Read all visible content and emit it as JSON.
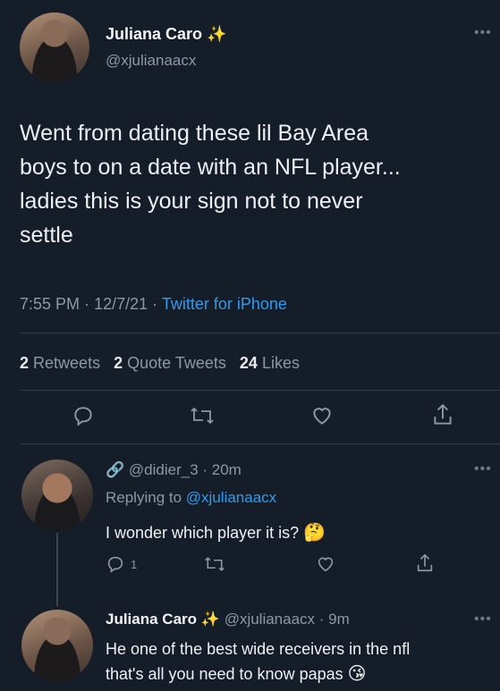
{
  "tweet": {
    "author_name": "Juliana Caro",
    "author_badge": "✨",
    "author_handle": "@xjulianaacx",
    "text_lines": [
      "Went from dating these lil Bay Area",
      "boys to on a date with an NFL player...",
      "ladies this is your sign not to never",
      "settle"
    ],
    "time": "7:55 PM",
    "date": "12/7/21",
    "separator": "·",
    "source": "Twitter for iPhone",
    "stats": {
      "retweets_count": "2",
      "retweets_label": "Retweets",
      "quotes_count": "2",
      "quotes_label": "Quote Tweets",
      "likes_count": "24",
      "likes_label": "Likes"
    }
  },
  "replies": [
    {
      "badge": "🔗",
      "handle": "@didier_3",
      "meta": "· 20m",
      "replying_prefix": "Replying to",
      "replying_to": "@xjulianaacx",
      "text": "I wonder which player it is?",
      "emoji": "🤔",
      "reply_count": "1"
    },
    {
      "name": "Juliana Caro",
      "badge": "✨",
      "handle": "@xjulianaacx",
      "meta": "· 9m",
      "text_lines": [
        "He one of the best wide receivers in the nfl",
        "that's all you need to know papas"
      ],
      "emoji": "😘"
    }
  ],
  "icons": {
    "more": "•••",
    "reply": "reply-icon",
    "retweet": "retweet-icon",
    "like": "like-icon",
    "share": "share-icon"
  },
  "colors": {
    "background": "#151d29",
    "link": "#2f9bf0",
    "muted": "#8b98a5"
  }
}
